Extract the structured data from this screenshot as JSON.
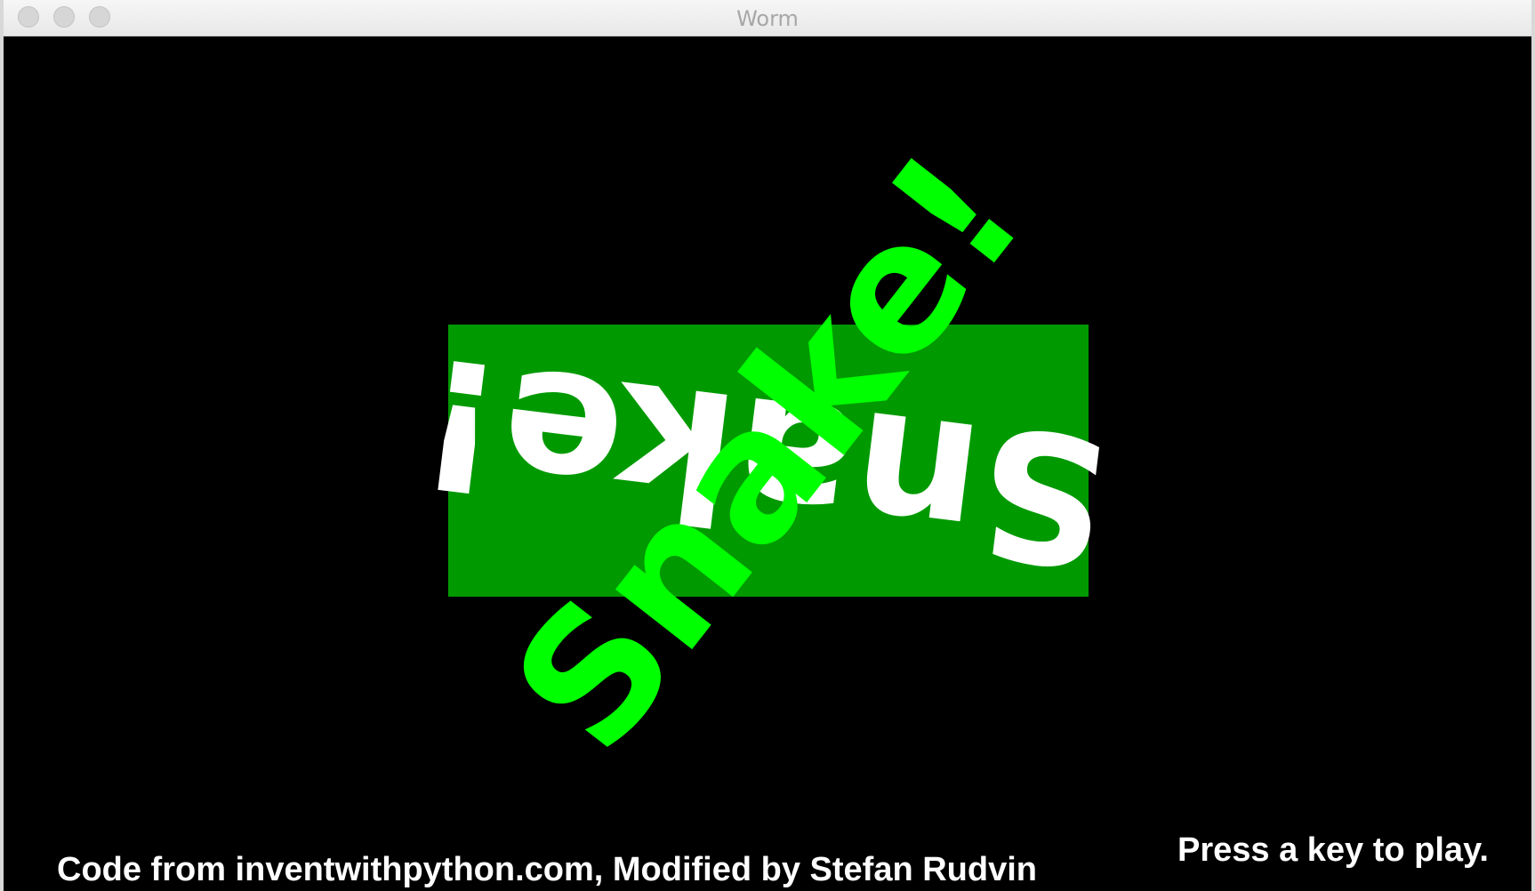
{
  "window": {
    "title": "Worm"
  },
  "title_screen": {
    "white_title": "Snake!",
    "green_title": "Snake!",
    "instructions": "Press a key to play.",
    "credits": "Code from inventwithpython.com, Modified by Stefan Rudvin"
  },
  "colors": {
    "background": "#000000",
    "banner": "#009a00",
    "green_text": "#00ff00",
    "white_text": "#ffffff"
  }
}
